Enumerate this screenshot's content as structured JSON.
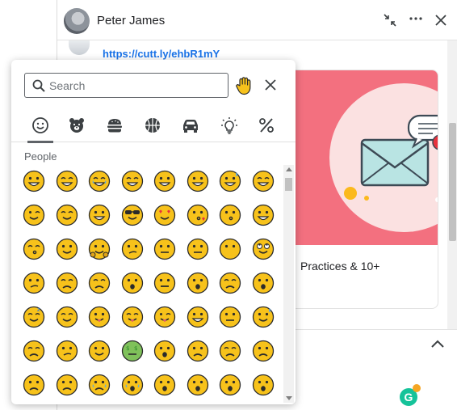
{
  "chat": {
    "contact_name": "Peter James",
    "message_link": "https://cutt.ly/ehbR1mY",
    "card_caption": "Practices & 10+",
    "icons": {
      "minimize": "minimize-arrows-icon",
      "more": "more-horizontal-icon",
      "close": "close-icon",
      "expand": "chevron-up-icon"
    }
  },
  "emoji_picker": {
    "search": {
      "placeholder": "Search",
      "value": ""
    },
    "skin_tone_icon": "raised-hand-icon",
    "categories": [
      {
        "name": "smileys",
        "icon": "smiley-icon",
        "active": true
      },
      {
        "name": "animals",
        "icon": "bear-icon"
      },
      {
        "name": "food",
        "icon": "burger-icon"
      },
      {
        "name": "activities",
        "icon": "ball-icon"
      },
      {
        "name": "travel",
        "icon": "car-icon"
      },
      {
        "name": "objects",
        "icon": "lightbulb-icon"
      },
      {
        "name": "symbols",
        "icon": "percent-icon"
      }
    ],
    "section_label": "People",
    "emojis": [
      [
        "grinning",
        "beaming",
        "joy",
        "rofl",
        "smiley",
        "smile",
        "sweat-smile",
        "laughing"
      ],
      [
        "wink",
        "blush",
        "yum",
        "sunglasses",
        "heart-eyes",
        "kissing-heart",
        "kissing",
        "kissing-smile"
      ],
      [
        "kissing-closed",
        "slightly-smiling",
        "hugging",
        "thinking",
        "neutral",
        "expressionless",
        "no-mouth",
        "eye-roll"
      ],
      [
        "smirk",
        "persevere",
        "disappointed-relieved",
        "hushed",
        "zipper",
        "open-mouth",
        "sleepy",
        "tired"
      ],
      [
        "sleeping",
        "relieved",
        "tongue",
        "squint-tongue",
        "wink-tongue",
        "drooling",
        "unamused",
        "sweat"
      ],
      [
        "pensive",
        "confused",
        "upside-down",
        "money-mouth",
        "astonished",
        "frowning",
        "confounded",
        "disappointed"
      ],
      [
        "worried",
        "triumph",
        "cry",
        "sob",
        "frowning-open",
        "anguished",
        "fearful",
        "weary"
      ]
    ]
  },
  "colors": {
    "link": "#1a73e8",
    "card_background": "#f3707f",
    "emoji_face": "#f7c21b",
    "grammarly": "#15c39a"
  }
}
